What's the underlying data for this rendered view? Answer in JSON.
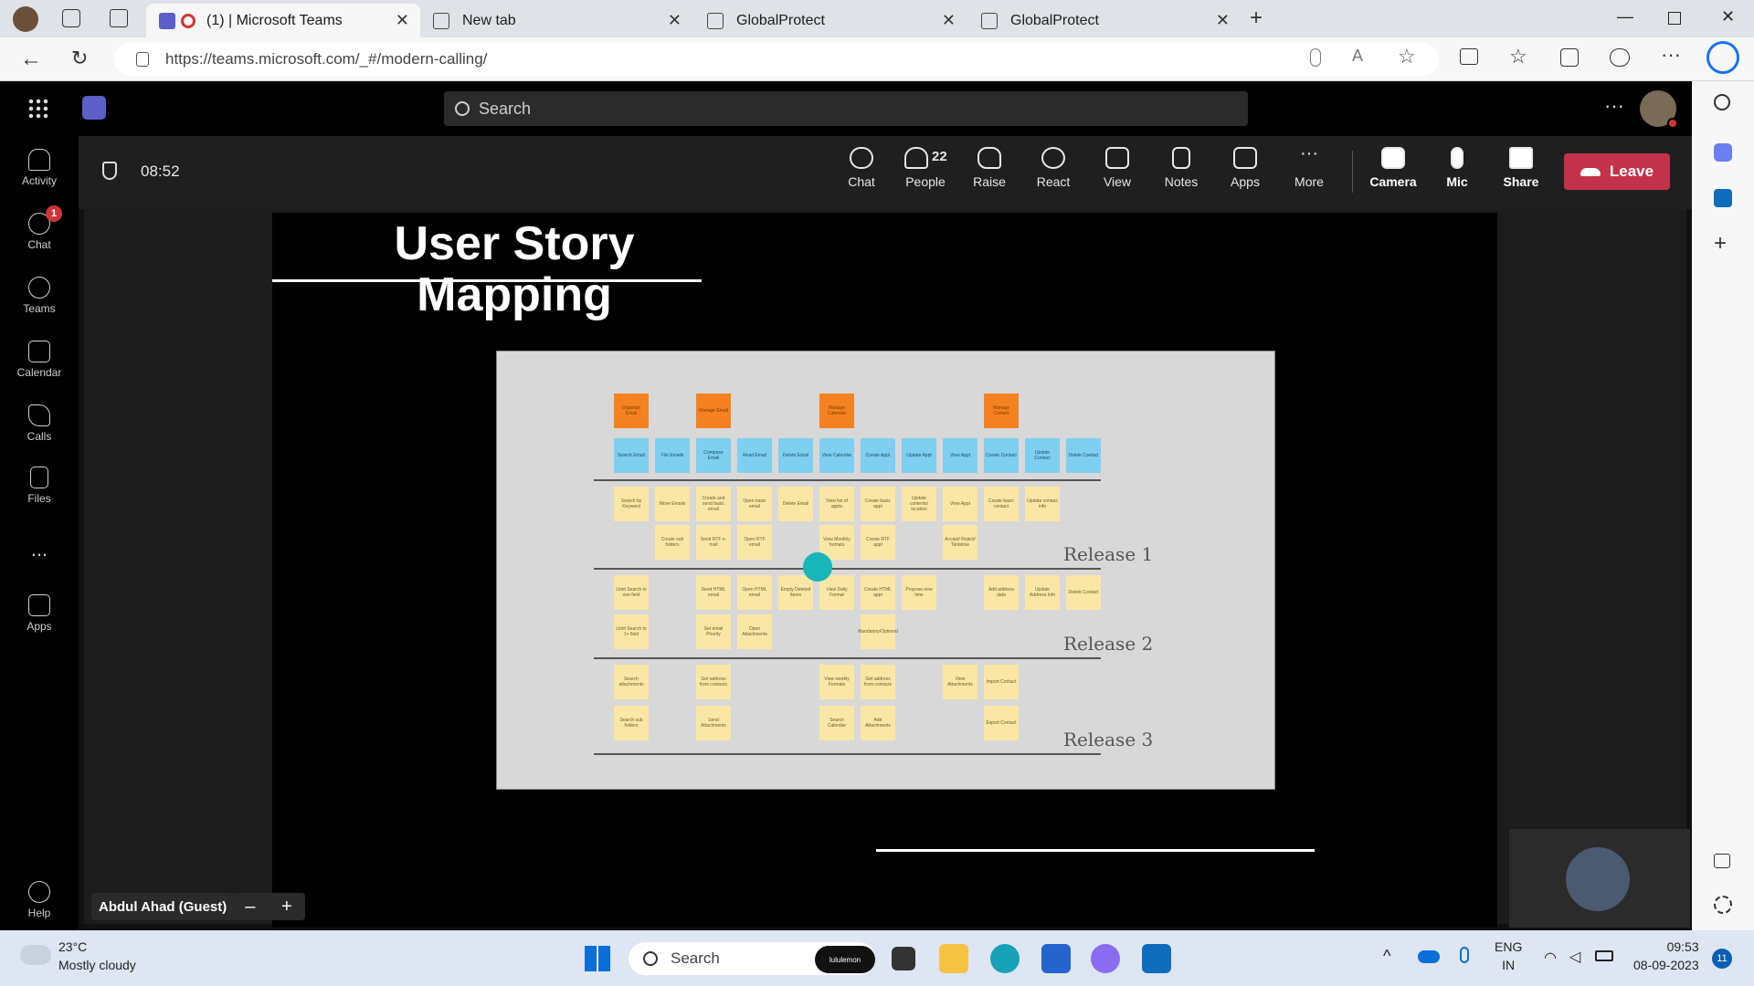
{
  "browser": {
    "tabs": [
      {
        "title": "(1) | Microsoft Teams",
        "active": true
      },
      {
        "title": "New tab",
        "active": false
      },
      {
        "title": "GlobalProtect",
        "active": false
      },
      {
        "title": "GlobalProtect",
        "active": false
      }
    ],
    "url": "https://teams.microsoft.com/_#/modern-calling/"
  },
  "teams": {
    "search_placeholder": "Search",
    "rail": [
      {
        "label": "Activity",
        "icon": "bell-icon"
      },
      {
        "label": "Chat",
        "icon": "chat-icon",
        "badge": "1"
      },
      {
        "label": "Teams",
        "icon": "teams-icon"
      },
      {
        "label": "Calendar",
        "icon": "calendar-icon"
      },
      {
        "label": "Calls",
        "icon": "phone-icon"
      },
      {
        "label": "Files",
        "icon": "file-icon"
      },
      {
        "label": "...",
        "icon": "more-icon"
      },
      {
        "label": "Apps",
        "icon": "apps-icon"
      },
      {
        "label": "Help",
        "icon": "help-icon"
      }
    ]
  },
  "meeting": {
    "timer": "08:52",
    "controls": [
      {
        "label": "Chat",
        "icon": "chat-icon"
      },
      {
        "label": "People",
        "icon": "people-icon",
        "count": "22"
      },
      {
        "label": "Raise",
        "icon": "hand-icon"
      },
      {
        "label": "React",
        "icon": "smile-icon"
      },
      {
        "label": "View",
        "icon": "view-icon"
      },
      {
        "label": "Notes",
        "icon": "notes-icon"
      },
      {
        "label": "Apps",
        "icon": "plus-box-icon"
      },
      {
        "label": "More",
        "icon": "ellipsis-icon"
      },
      {
        "label": "Camera",
        "icon": "camera-off-icon"
      },
      {
        "label": "Mic",
        "icon": "mic-off-icon"
      },
      {
        "label": "Share",
        "icon": "share-icon"
      }
    ],
    "leave_label": "Leave",
    "presenter_name": "Abdul Ahad (Guest)",
    "slide": {
      "title_line1": "User Story",
      "title_line2": "Mapping",
      "releases": [
        "Release 1",
        "Release 2",
        "Release 3"
      ],
      "activities": [
        "Organize Email",
        "Manage Email",
        "Manage Calendar",
        "Manage Contact"
      ],
      "tasks": [
        "Search Email",
        "File Emails",
        "Compose Email",
        "Read Email",
        "Delete Email",
        "View Calendar",
        "Create Appt",
        "Update Appt",
        "View Appt",
        "Create Contact",
        "Update Contact",
        "Delete Contact"
      ],
      "stories_r1": [
        "Search by Keyword",
        "Move Emails",
        "Create and send basic email",
        "Open basic email",
        "Delete Email",
        "View list of appts",
        "Create basic appt",
        "Update contents/ location",
        "View Appt",
        "Create basic contact",
        "Update contact info",
        "Create sub folders",
        "Send RTF e-mail",
        "Open RTF email",
        "View Monthly formats",
        "Create RTF appt",
        "Accept/ Reject/ Tentative"
      ],
      "stories_r2": [
        "Limit Search to one field",
        "Send HTML email",
        "Open HTML email",
        "Empty Deleted Items",
        "View Daily Format",
        "Create HTML appt",
        "Propose new time",
        "Add address data",
        "Update Address Info",
        "Delete Contact",
        "Limit Search to 1+ field",
        "Set email Priority",
        "Open Attachments",
        "Mandatory/Optional"
      ],
      "stories_r3": [
        "Search attachments",
        "Get address from contacts",
        "View weekly Formats",
        "Get address from contacts",
        "View Attachments",
        "Import Contact",
        "Search sub folders",
        "Send Attachments",
        "Search Calendar",
        "Add Attachments",
        "Export Contact"
      ]
    }
  },
  "taskbar": {
    "weather_temp": "23°C",
    "weather_desc": "Mostly cloudy",
    "search_placeholder": "Search",
    "search_badge": "lululemon",
    "lang1": "ENG",
    "lang2": "IN",
    "time": "09:53",
    "date": "08-09-2023",
    "notif_count": "11"
  }
}
